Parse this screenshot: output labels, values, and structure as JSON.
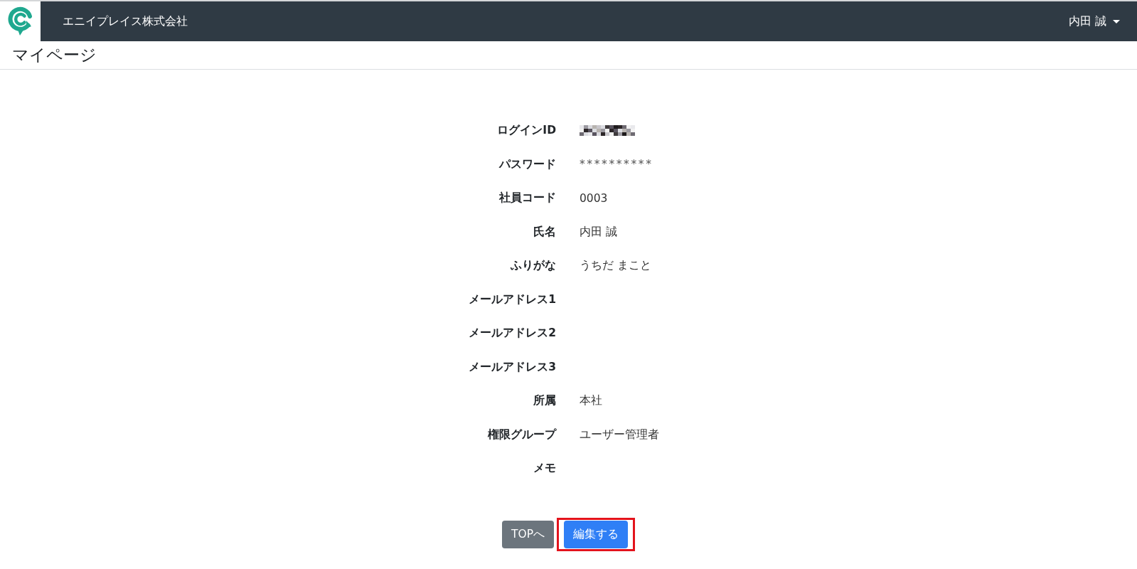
{
  "header": {
    "company": "エニイプレイス株式会社",
    "user_menu": {
      "label": "内田 誠"
    }
  },
  "page_title": "マイページ",
  "fields": [
    {
      "label": "ログインID",
      "kind": "redacted"
    },
    {
      "label": "パスワード",
      "kind": "masked",
      "value": "**********"
    },
    {
      "label": "社員コード",
      "kind": "text",
      "value": "0003"
    },
    {
      "label": "氏名",
      "kind": "text",
      "value": "内田 誠"
    },
    {
      "label": "ふりがな",
      "kind": "text",
      "value": "うちだ まこと"
    },
    {
      "label": "メールアドレス1",
      "kind": "blank"
    },
    {
      "label": "メールアドレス2",
      "kind": "blank"
    },
    {
      "label": "メールアドレス3",
      "kind": "blank"
    },
    {
      "label": "所属",
      "kind": "text",
      "value": "本社"
    },
    {
      "label": "権限グループ",
      "kind": "text",
      "value": "ユーザー管理者"
    },
    {
      "label": "メモ",
      "kind": "blank"
    }
  ],
  "actions": [
    {
      "label": "TOPへ",
      "kind": "secondary",
      "highlighted": false
    },
    {
      "label": "編集する",
      "kind": "primary",
      "highlighted": true
    }
  ]
}
